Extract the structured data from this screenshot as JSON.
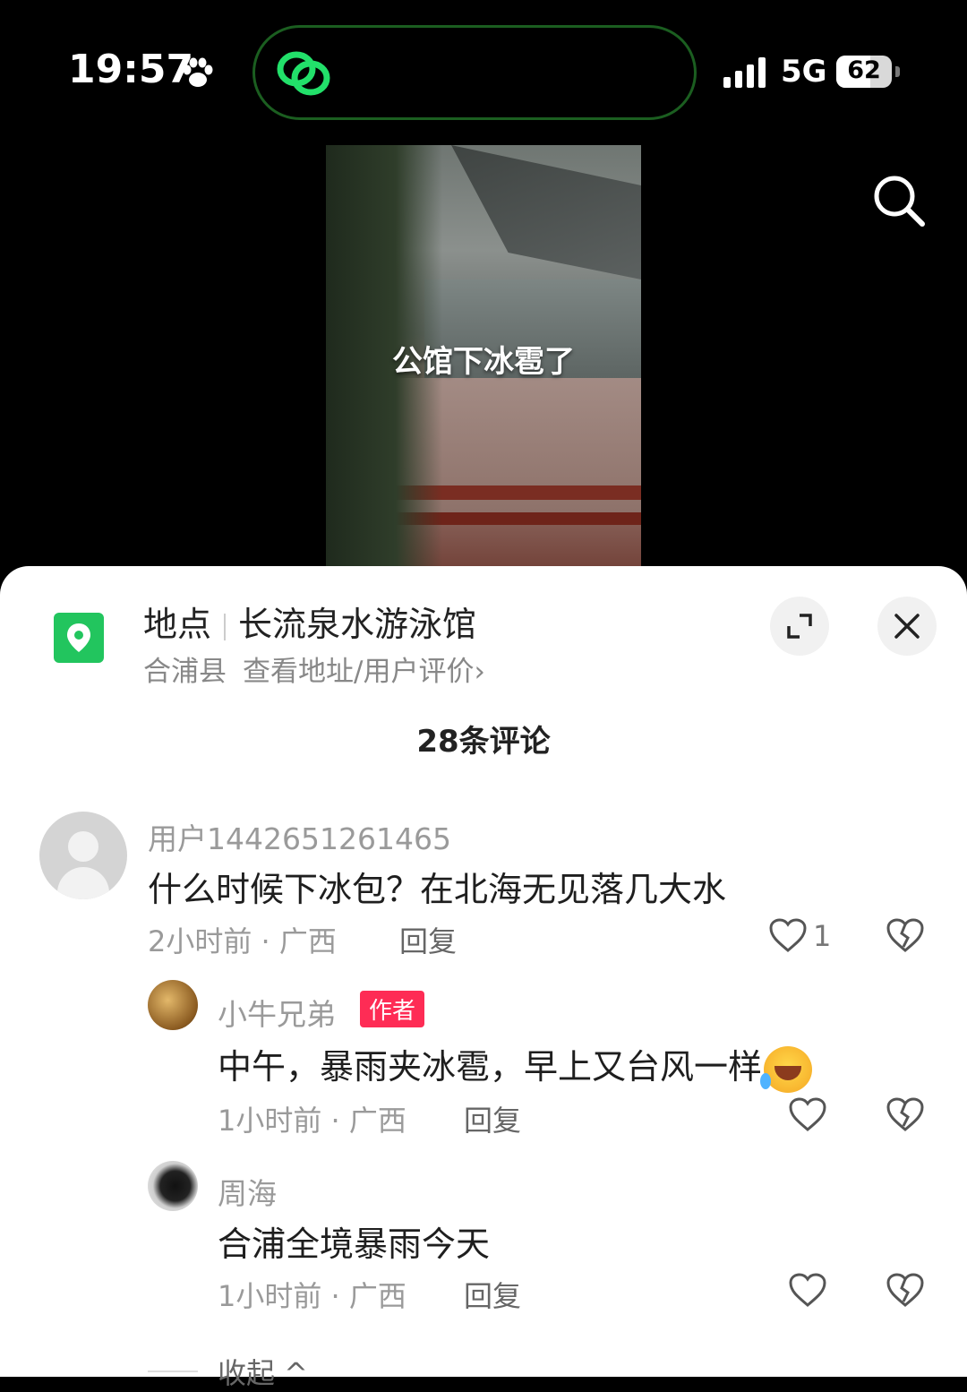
{
  "status_bar": {
    "time": "19:57",
    "network": "5G",
    "battery": "62",
    "battery_level_pct": 62
  },
  "video": {
    "caption": "公馆下冰雹了"
  },
  "location": {
    "label": "地点",
    "name": "长流泉水游泳馆",
    "county": "合浦县",
    "link": "查看地址/用户评价",
    "link_arrow": "›"
  },
  "comments_count_label": "28条评论",
  "comments": [
    {
      "username": "用户1442651261465",
      "text": "什么时候下冰包？在北海无见落几大水",
      "meta": "2小时前 · 广西",
      "reply_label": "回复",
      "likes": "1"
    },
    {
      "username": "小牛兄弟",
      "badge": "作者",
      "text": "中午，暴雨夹冰雹，早上又台风一样",
      "emoji": "rolling-on-floor-laughing",
      "meta": "1小时前 · 广西",
      "reply_label": "回复"
    },
    {
      "username": "周海",
      "text": "合浦全境暴雨今天",
      "meta": "1小时前 · 广西",
      "reply_label": "回复"
    }
  ],
  "collapse_label": "收起 ^",
  "colors": {
    "accent_red": "#fe2c55",
    "location_green": "#22c55e"
  }
}
